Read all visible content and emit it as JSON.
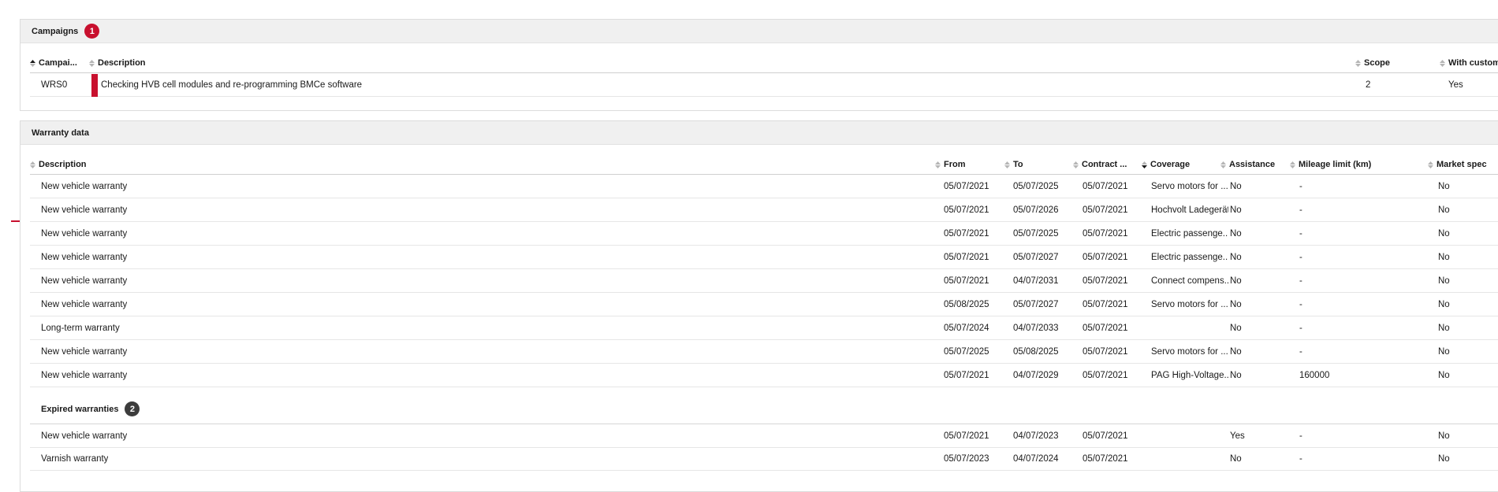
{
  "campaigns": {
    "title": "Campaigns",
    "count": "1",
    "columns": {
      "campaign": "Campai...",
      "description": "Description",
      "scope": "Scope",
      "with_letter": "With customer let"
    },
    "rows": [
      {
        "campaign": "WRS0",
        "description": "Checking HVB cell modules and re-programming BMCe software",
        "scope": "2",
        "with_letter": "Yes"
      }
    ]
  },
  "warranty": {
    "title": "Warranty data",
    "columns": {
      "description": "Description",
      "from": "From",
      "to": "To",
      "contract": "Contract ...",
      "coverage": "Coverage",
      "assistance": "Assistance",
      "mileage": "Mileage limit (km)",
      "market": "Market spec"
    },
    "rows": [
      {
        "description": "New vehicle warranty",
        "from": "05/07/2021",
        "to": "05/07/2025",
        "contract": "05/07/2021",
        "coverage": "Servo motors for ...",
        "assistance": "No",
        "mileage": "-",
        "market": "No"
      },
      {
        "description": "New vehicle warranty",
        "from": "05/07/2021",
        "to": "05/07/2026",
        "contract": "05/07/2021",
        "coverage": "Hochvolt Ladegerät",
        "assistance": "No",
        "mileage": "-",
        "market": "No"
      },
      {
        "description": "New vehicle warranty",
        "from": "05/07/2021",
        "to": "05/07/2025",
        "contract": "05/07/2021",
        "coverage": "Electric passenge...",
        "assistance": "No",
        "mileage": "-",
        "market": "No"
      },
      {
        "description": "New vehicle warranty",
        "from": "05/07/2021",
        "to": "05/07/2027",
        "contract": "05/07/2021",
        "coverage": "Electric passenge...",
        "assistance": "No",
        "mileage": "-",
        "market": "No"
      },
      {
        "description": "New vehicle warranty",
        "from": "05/07/2021",
        "to": "04/07/2031",
        "contract": "05/07/2021",
        "coverage": "Connect compens...",
        "assistance": "No",
        "mileage": "-",
        "market": "No"
      },
      {
        "description": "New vehicle warranty",
        "from": "05/08/2025",
        "to": "05/07/2027",
        "contract": "05/07/2021",
        "coverage": "Servo motors for ...",
        "assistance": "No",
        "mileage": "-",
        "market": "No"
      },
      {
        "description": "Long-term warranty",
        "from": "05/07/2024",
        "to": "04/07/2033",
        "contract": "05/07/2021",
        "coverage": "",
        "assistance": "No",
        "mileage": "-",
        "market": "No"
      },
      {
        "description": "New vehicle warranty",
        "from": "05/07/2025",
        "to": "05/08/2025",
        "contract": "05/07/2021",
        "coverage": "Servo motors for ...",
        "assistance": "No",
        "mileage": "-",
        "market": "No"
      },
      {
        "description": "New vehicle warranty",
        "from": "05/07/2021",
        "to": "04/07/2029",
        "contract": "05/07/2021",
        "coverage": "PAG High-Voltage...",
        "assistance": "No",
        "mileage": "160000",
        "market": "No"
      }
    ],
    "expired": {
      "title": "Expired warranties",
      "count": "2",
      "rows": [
        {
          "description": "New vehicle warranty",
          "from": "05/07/2021",
          "to": "04/07/2023",
          "contract": "05/07/2021",
          "coverage": "",
          "assistance": "Yes",
          "mileage": "-",
          "market": "No"
        },
        {
          "description": "Varnish warranty",
          "from": "05/07/2023",
          "to": "04/07/2024",
          "contract": "05/07/2021",
          "coverage": "",
          "assistance": "No",
          "mileage": "-",
          "market": "No"
        }
      ]
    }
  },
  "colors": {
    "accent_red": "#c8102e",
    "badge_dark": "#3c3c3c",
    "header_bg": "#f0f0f0"
  },
  "icons": {
    "sort": "sort-arrows-icon"
  }
}
